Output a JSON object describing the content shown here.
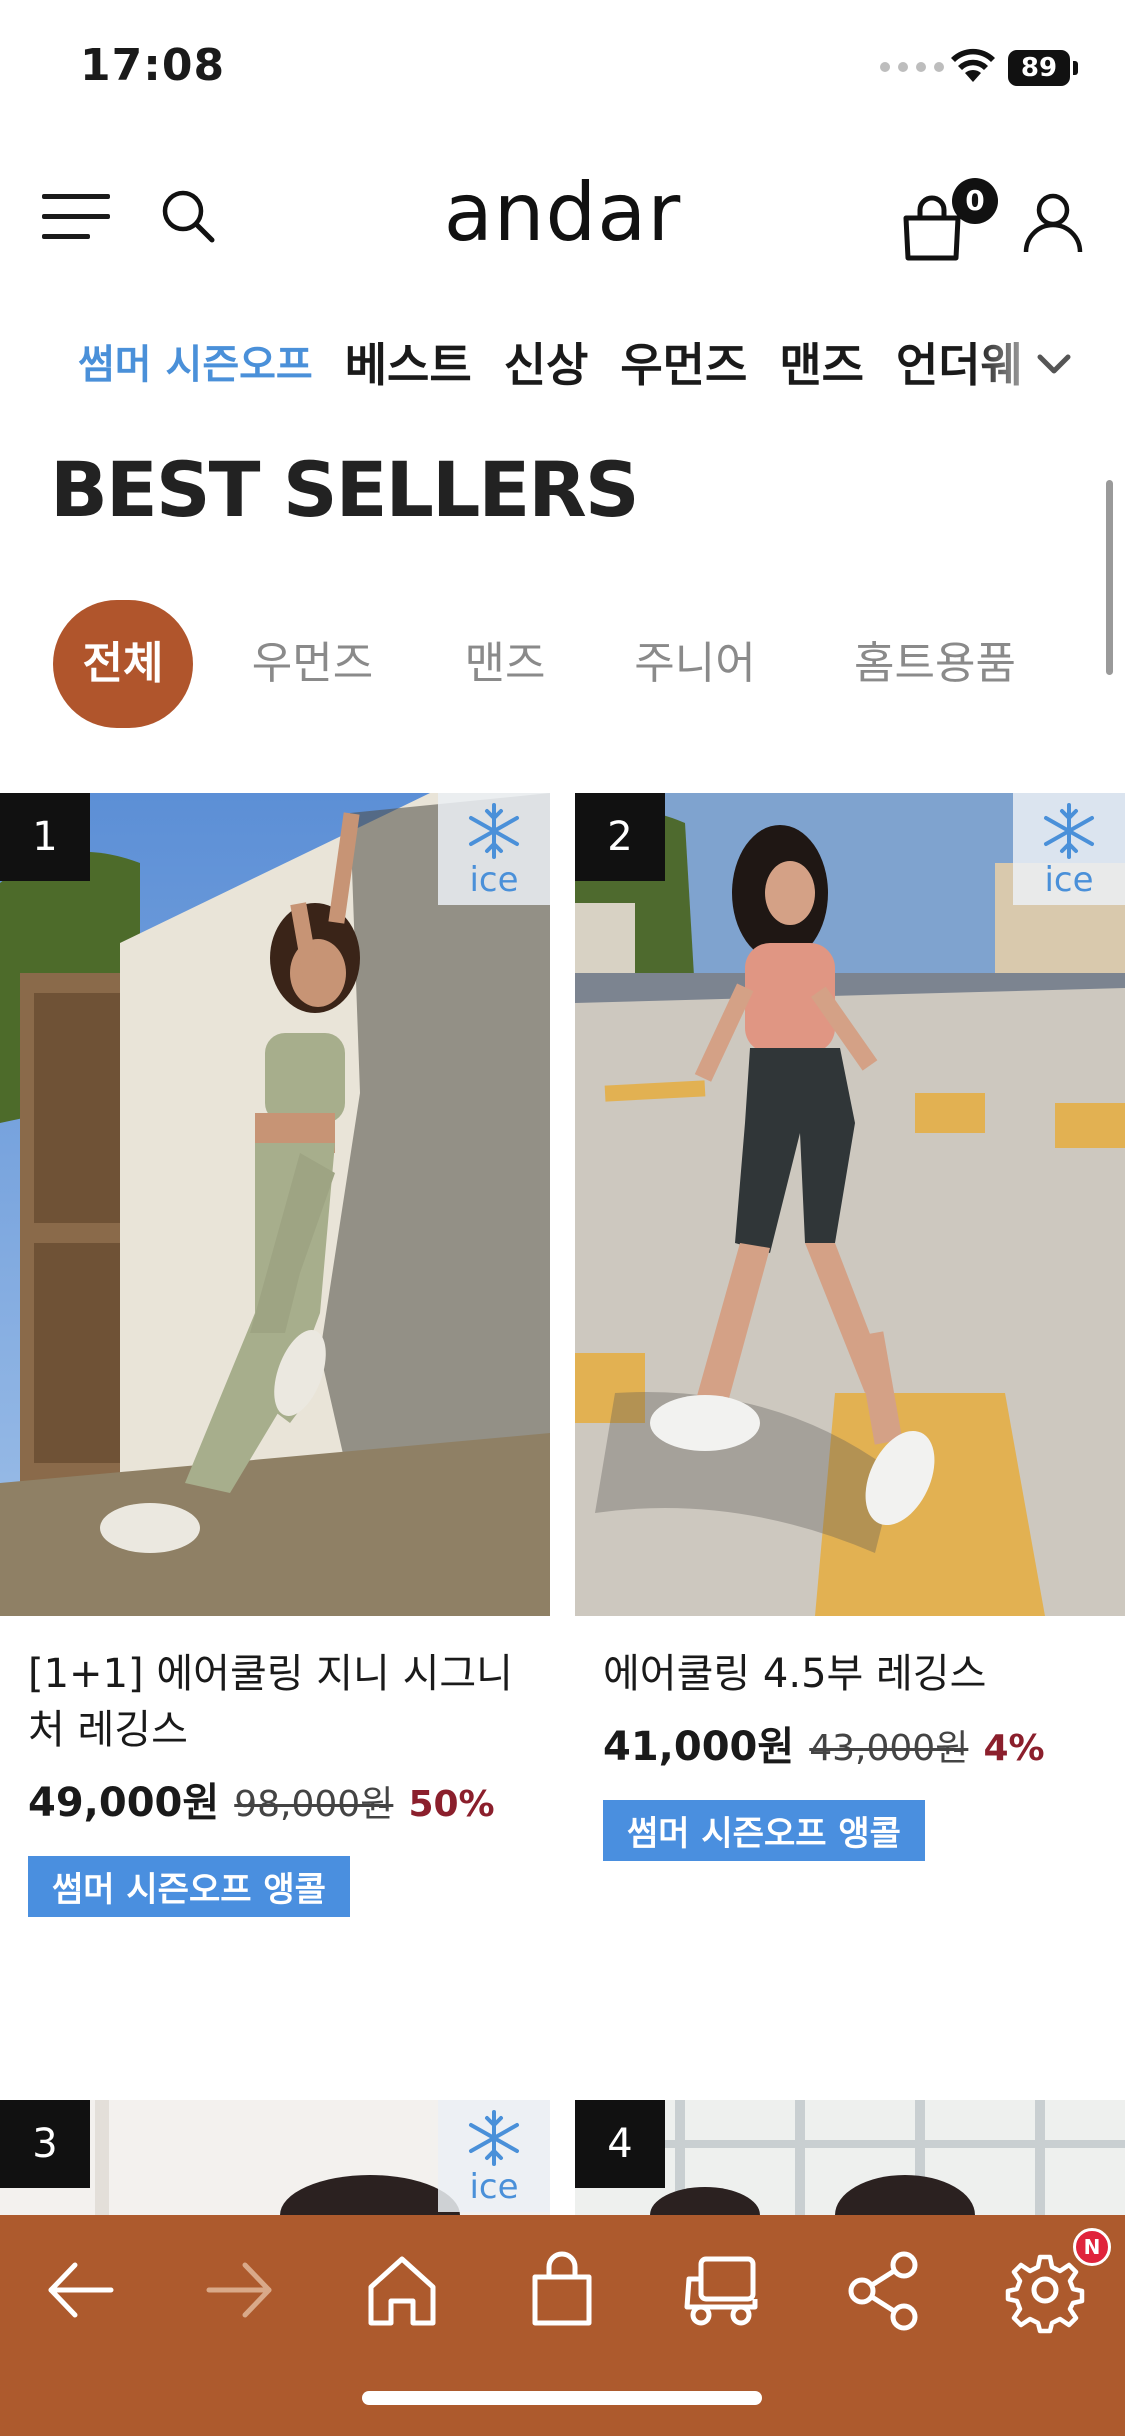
{
  "status_bar": {
    "time": "17:08",
    "battery": "89"
  },
  "header": {
    "logo": "andar",
    "cart_count": "0"
  },
  "category_nav": {
    "items": [
      {
        "label": "썸머 시즌오프",
        "active": true
      },
      {
        "label": "베스트"
      },
      {
        "label": "신상"
      },
      {
        "label": "우먼즈"
      },
      {
        "label": "맨즈"
      },
      {
        "label": "언더웨"
      }
    ]
  },
  "section": {
    "title": "BEST SELLERS"
  },
  "filter_tabs": [
    {
      "label": "전체",
      "active": true
    },
    {
      "label": "우먼즈"
    },
    {
      "label": "맨즈"
    },
    {
      "label": "주니어"
    },
    {
      "label": "홈트용품"
    }
  ],
  "products": [
    {
      "rank": "1",
      "badge": "ice",
      "name": "[1+1] 에어쿨링 지니 시그니처 레깅스",
      "price": "49,000원",
      "original_price": "98,000원",
      "discount": "50%",
      "tag": "썸머 시즌오프 앵콜"
    },
    {
      "rank": "2",
      "badge": "ice",
      "name": "에어쿨링 4.5부 레깅스",
      "price": "41,000원",
      "original_price": "43,000원",
      "discount": "4%",
      "tag": "썸머 시즌오프 앵콜"
    },
    {
      "rank": "3",
      "badge": "ice"
    },
    {
      "rank": "4"
    }
  ],
  "toolbar": {
    "items": [
      "back-arrow-icon",
      "forward-arrow-icon",
      "home-icon",
      "shopping-bag-icon",
      "delivery-truck-icon",
      "share-icon",
      "settings-gear-icon"
    ],
    "notification": "N"
  },
  "colors": {
    "accent": "#b0552c",
    "toolbar": "#ad5a2d",
    "nav_active": "#4a90d9",
    "tag": "#4a8fdf",
    "discount": "#8b1f2c"
  }
}
